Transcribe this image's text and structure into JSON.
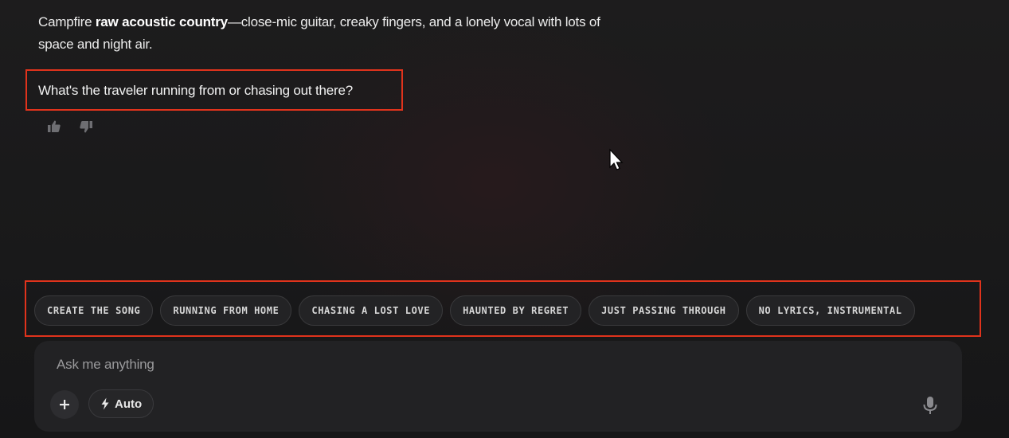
{
  "message": {
    "prefix": "Campfire ",
    "bold": "raw acoustic country",
    "suffix": "—close-mic guitar, creaky fingers, and a lonely vocal with lots of space and night air."
  },
  "question": "What's the traveler running from or chasing out there?",
  "feedback": {
    "like_icon": "thumbs-up-icon",
    "dislike_icon": "thumbs-down-icon"
  },
  "suggestions": [
    "CREATE THE SONG",
    "RUNNING FROM HOME",
    "CHASING A LOST LOVE",
    "HAUNTED BY REGRET",
    "JUST PASSING THROUGH",
    "NO LYRICS, INSTRUMENTAL"
  ],
  "composer": {
    "placeholder": "Ask me anything",
    "add_icon": "plus-icon",
    "mode_icon": "lightning-icon",
    "mode_label": "Auto",
    "mic_icon": "microphone-icon"
  },
  "colors": {
    "highlight_border": "#e0331c",
    "background": "#1a1a1b"
  }
}
